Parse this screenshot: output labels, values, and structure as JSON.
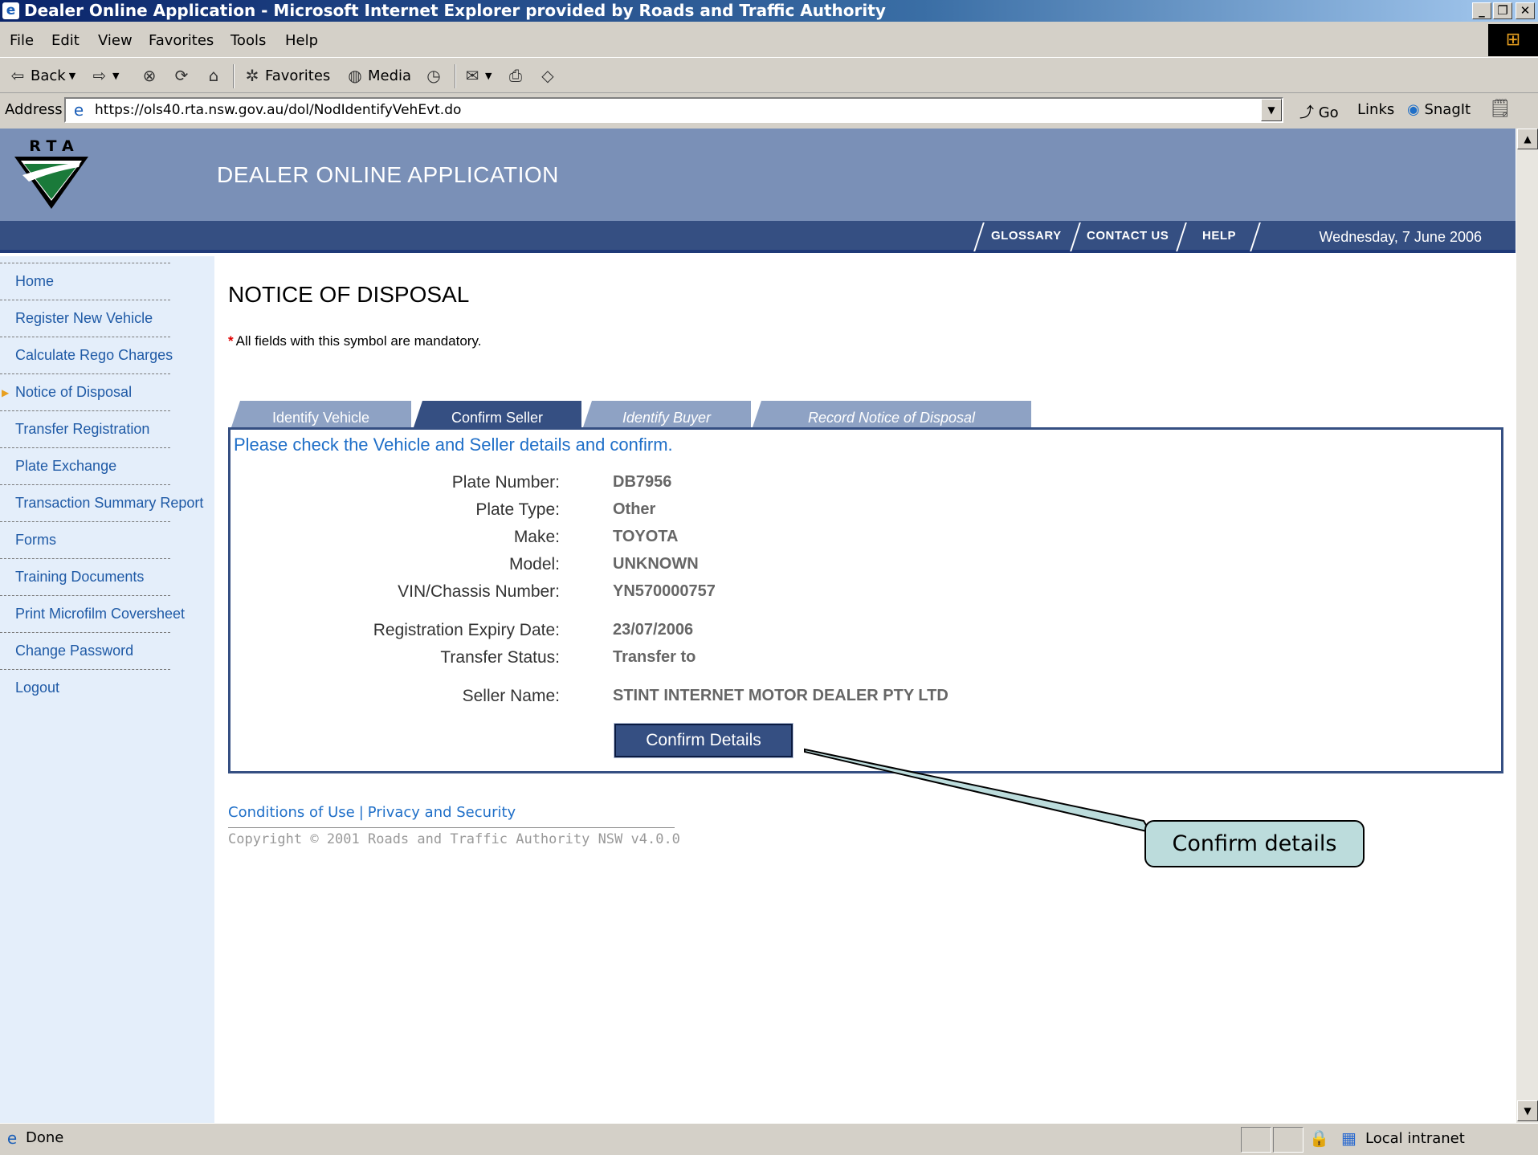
{
  "window": {
    "title": "Dealer Online Application - Microsoft Internet Explorer provided by Roads and Traffic Authority"
  },
  "menu": [
    "File",
    "Edit",
    "View",
    "Favorites",
    "Tools",
    "Help"
  ],
  "toolbar": {
    "back": "Back",
    "favorites": "Favorites",
    "media": "Media"
  },
  "address": {
    "label": "Address",
    "url": "https://ols40.rta.nsw.gov.au/dol/NodIdentifyVehEvt.do",
    "go": "Go",
    "links": "Links",
    "snagit": "SnagIt"
  },
  "site": {
    "logo_text": "R T A",
    "app_title": "DEALER ONLINE APPLICATION",
    "nav": [
      "GLOSSARY",
      "CONTACT US",
      "HELP"
    ],
    "date": "Wednesday, 7 June 2006"
  },
  "sidebar": {
    "items": [
      {
        "label": "Home"
      },
      {
        "label": "Register New Vehicle"
      },
      {
        "label": "Calculate Rego Charges"
      },
      {
        "label": "Notice of Disposal",
        "active": true
      },
      {
        "label": "Transfer Registration"
      },
      {
        "label": "Plate Exchange"
      },
      {
        "label": "Transaction Summary Report"
      },
      {
        "label": "Forms"
      },
      {
        "label": "Training Documents"
      },
      {
        "label": "Print Microfilm Coversheet"
      },
      {
        "label": "Change Password"
      },
      {
        "label": "Logout"
      }
    ]
  },
  "main": {
    "title": "NOTICE OF DISPOSAL",
    "mandatory_note": "All fields with this symbol are mandatory.",
    "tabs": [
      "Identify Vehicle",
      "Confirm Seller",
      "Identify Buyer",
      "Record Notice of Disposal"
    ],
    "active_tab": "Confirm Seller",
    "instruction": "Please check the Vehicle and Seller details and confirm.",
    "fields": [
      {
        "label": "Plate Number:",
        "value": "DB7956"
      },
      {
        "label": "Plate Type:",
        "value": "Other"
      },
      {
        "label": "Make:",
        "value": "TOYOTA"
      },
      {
        "label": "Model:",
        "value": "UNKNOWN"
      },
      {
        "label": "VIN/Chassis Number:",
        "value": "YN570000757"
      },
      {
        "label": "Registration Expiry Date:",
        "value": "23/07/2006"
      },
      {
        "label": "Transfer Status:",
        "value": "Transfer to"
      },
      {
        "label": "Seller Name:",
        "value": "STINT INTERNET MOTOR DEALER PTY LTD"
      }
    ],
    "confirm_button": "Confirm Details"
  },
  "footer": {
    "conditions": "Conditions of Use",
    "separator": "|",
    "privacy": "Privacy and Security",
    "copyright": "Copyright © 2001 Roads and Traffic Authority NSW v4.0.0"
  },
  "callout": {
    "text": "Confirm details"
  },
  "status": {
    "text": "Done",
    "zone": "Local intranet"
  },
  "colors": {
    "banner": "#7a90b7",
    "navbar": "#354f82",
    "sidebar_bg": "#e4eefa",
    "link": "#1f5aa6",
    "callout_bg": "#bcdcdc"
  }
}
